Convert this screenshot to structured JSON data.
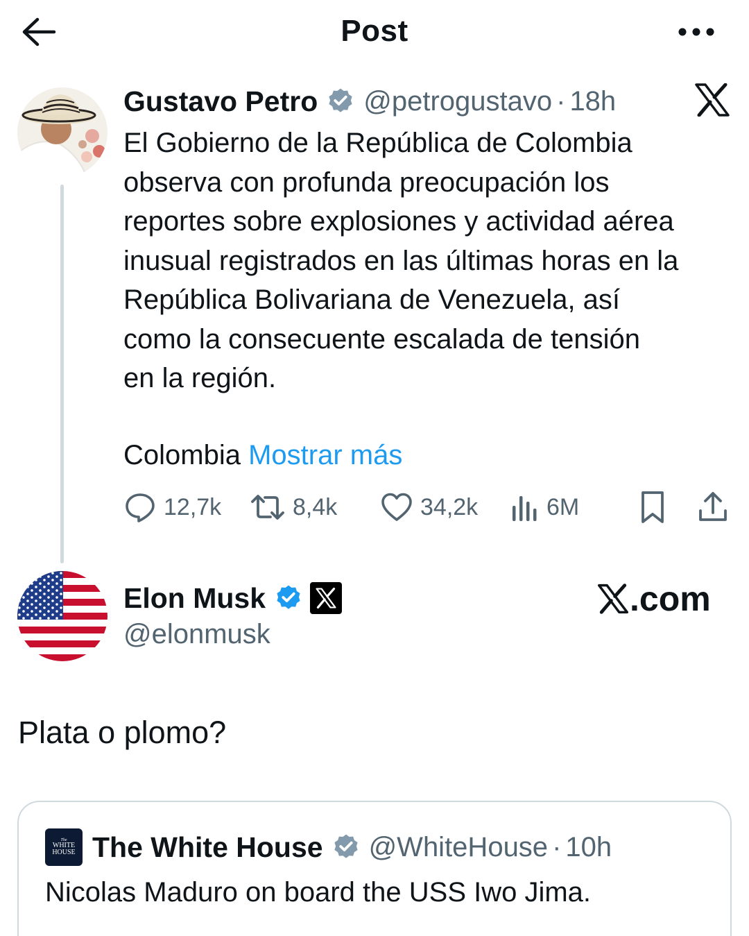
{
  "header": {
    "title": "Post"
  },
  "tweet1": {
    "name": "Gustavo Petro",
    "handle": "@petrogustavo",
    "separator": "·",
    "time": "18h",
    "body": "El Gobierno de la República de Colombia\nobserva con profunda preocupación los\nreportes sobre explosiones y actividad aérea\ninusual registrados en las últimas horas en la\nRepública Bolivariana de Venezuela, así\ncomo la consecuente escalada de tensión\nen la región.",
    "tail": "Colombia",
    "show_more": "Mostrar más",
    "stats": {
      "replies": "12,7k",
      "reposts": "8,4k",
      "likes": "34,2k",
      "views": "6M"
    }
  },
  "tweet2": {
    "name": "Elon Musk",
    "handle": "@elonmusk",
    "brand": ".com",
    "text": "Plata o plomo?"
  },
  "quote": {
    "name": "The White House",
    "handle": "@WhiteHouse",
    "separator": "·",
    "time": "10h",
    "text": "Nicolas Maduro on board the USS Iwo Jima.",
    "logo_text": {
      "small": "The",
      "line1": "WHITE",
      "line2": "HOUSE"
    }
  },
  "colors": {
    "accent": "#1d9bf0",
    "muted": "#536471",
    "text": "#0f1419",
    "border": "#cfd9de"
  },
  "icons": [
    "back-arrow-icon",
    "more-icon",
    "verified-icon",
    "x-logo-icon",
    "reply-icon",
    "repost-icon",
    "like-icon",
    "views-icon",
    "bookmark-icon",
    "share-icon"
  ]
}
